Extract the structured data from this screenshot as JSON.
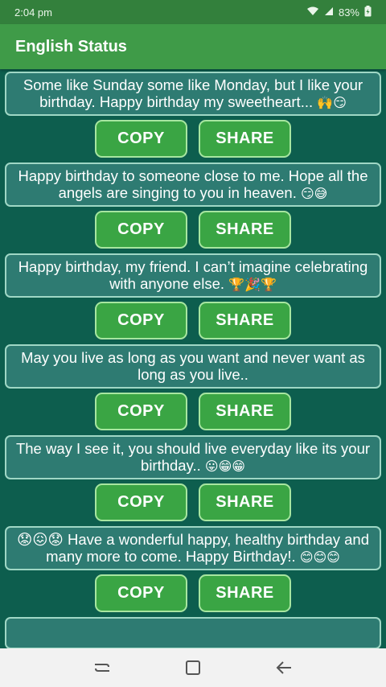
{
  "status_bar": {
    "time": "2:04 pm",
    "battery": "83%"
  },
  "app_bar": {
    "title": "English Status"
  },
  "buttons": {
    "copy_label": "COPY",
    "share_label": "SHARE"
  },
  "statuses": [
    {
      "text": "Some like Sunday some like Monday, but I like your birthday. Happy birthday my sweetheart...",
      "emoji": "🙌😏"
    },
    {
      "text": "Happy birthday to someone close to me. Hope all the angels are singing to you in heaven.",
      "emoji": "😏😅"
    },
    {
      "text": "Happy birthday, my friend. I can’t imagine celebrating with anyone else.",
      "emoji": "🏆🎉🏆"
    },
    {
      "text": "May you live as long as you want and never want as long as you live..",
      "emoji": ""
    },
    {
      "text": "The way I see it, you should live everyday like its your birthday..",
      "emoji": "😛😁😁"
    },
    {
      "text": "😟😖😟 Have a wonderful happy, healthy birthday and many more to come. Happy Birthday!.",
      "emoji": "😊😊😊"
    }
  ],
  "colors": {
    "status_bar": "#33803c",
    "app_bar": "#3f9b48",
    "background": "#0d5e4e",
    "card": "#2e7b72",
    "button": "#3aa544"
  },
  "icons": {
    "wifi": "wifi-icon",
    "signal": "signal-icon",
    "battery": "battery-icon",
    "nav_recent": "recent-apps-icon",
    "nav_home": "home-icon",
    "nav_back": "back-icon"
  }
}
